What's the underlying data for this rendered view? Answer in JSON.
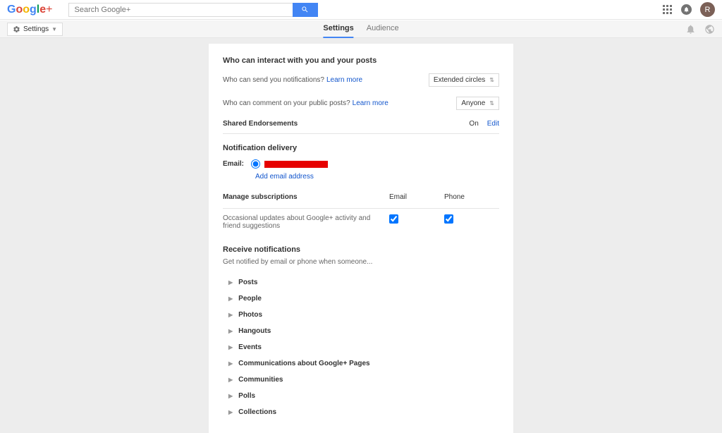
{
  "header": {
    "search_placeholder": "Search Google+",
    "avatar_letter": "R"
  },
  "subheader": {
    "settings_label": "Settings",
    "tabs": {
      "settings": "Settings",
      "audience": "Audience"
    }
  },
  "sections": {
    "interact": {
      "title": "Who can interact with you and your posts",
      "notif_label": "Who can send you notifications?",
      "notif_link": "Learn more",
      "notif_select": "Extended circles",
      "comment_label": "Who can comment on your public posts?",
      "comment_link": "Learn more",
      "comment_select": "Anyone"
    },
    "endorsements": {
      "title": "Shared Endorsements",
      "status": "On",
      "edit": "Edit"
    },
    "delivery": {
      "title": "Notification delivery",
      "email_label": "Email:",
      "add_email": "Add email address"
    },
    "subscriptions": {
      "title": "Manage subscriptions",
      "col_email": "Email",
      "col_phone": "Phone",
      "row1": "Occasional updates about Google+ activity and friend suggestions"
    },
    "receive": {
      "title": "Receive notifications",
      "subtext": "Get notified by email or phone when someone...",
      "items": [
        "Posts",
        "People",
        "Photos",
        "Hangouts",
        "Events",
        "Communications about Google+ Pages",
        "Communities",
        "Polls",
        "Collections"
      ]
    }
  }
}
